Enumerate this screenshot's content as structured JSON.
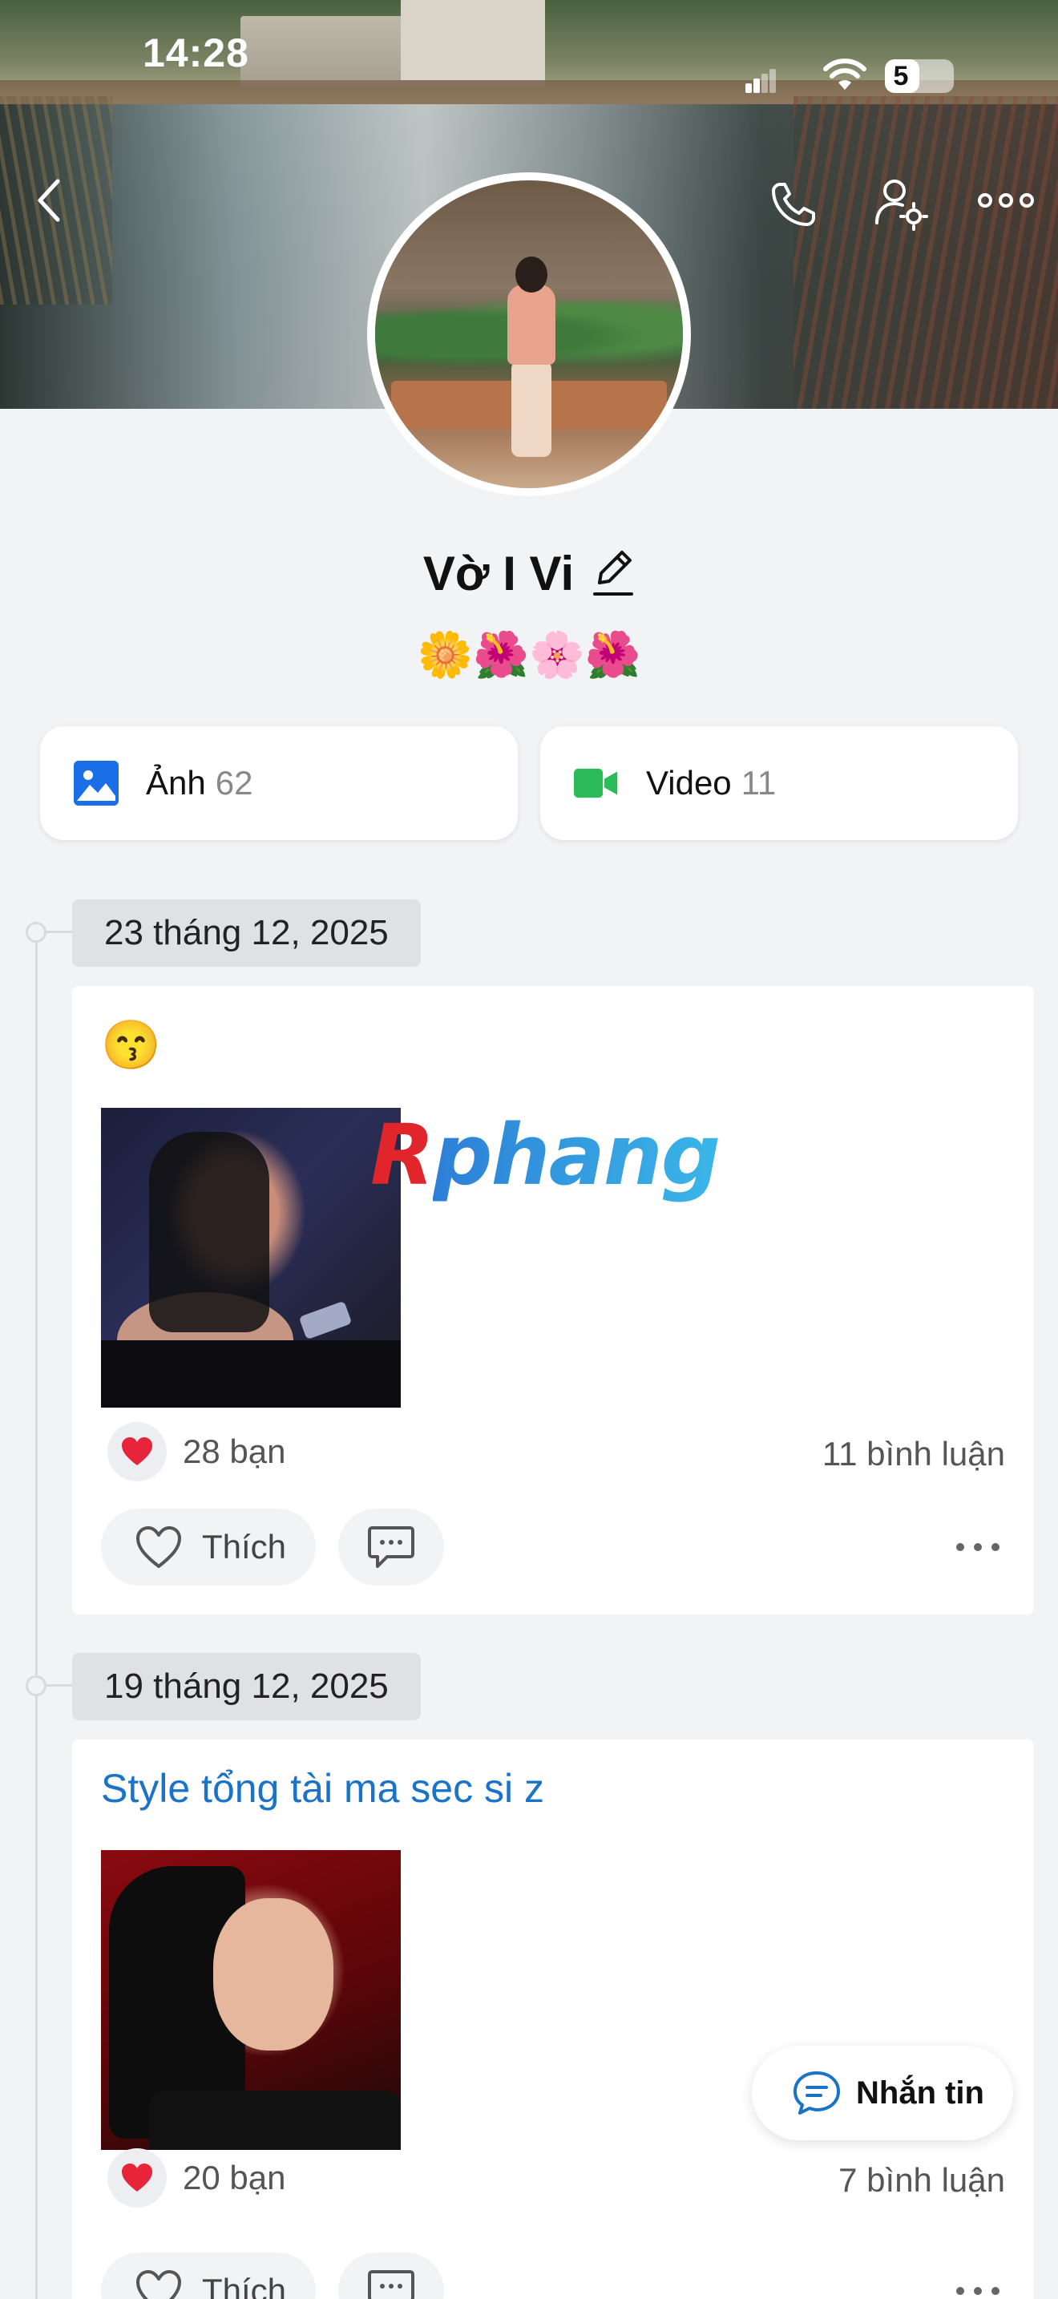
{
  "status_bar": {
    "time": "14:28",
    "battery": "5",
    "battery_level": 0.5
  },
  "header": {
    "back_icon": "chevron-left-icon",
    "call_icon": "phone-icon",
    "settings_icon": "user-settings-icon",
    "more_icon": "more-horizontal-icon"
  },
  "profile": {
    "name": "Vờ I Vi",
    "bio": "🌼🌺🌸🌺"
  },
  "media": {
    "photos_label": "Ảnh",
    "photos_count": "62",
    "videos_label": "Video",
    "videos_count": "11",
    "photo_color": "#1a6ee8",
    "video_color": "#2dbb5a"
  },
  "posts": [
    {
      "date": "23 tháng 12, 2025",
      "text": "😙",
      "reactions": "28 bạn",
      "comments": "11 bình luận",
      "like_label": "Thích"
    },
    {
      "date": "19 tháng 12, 2025",
      "text": "Style tổng tài ma sec si z",
      "reactions": "20 bạn",
      "comments": "7 bình luận",
      "like_label": "Thích"
    }
  ],
  "watermark": {
    "first": "R",
    "rest": "phang"
  },
  "message_button": {
    "label": "Nhắn tin"
  },
  "colors": {
    "accent": "#1a73c8",
    "heart": "#e8243b"
  }
}
